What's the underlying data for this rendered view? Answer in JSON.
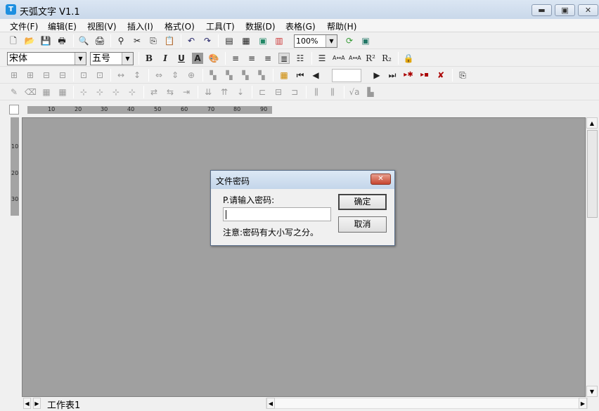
{
  "window": {
    "title": "天弧文字 V1.1",
    "app_icon": "T",
    "controls": [
      "minimize",
      "restore",
      "close"
    ]
  },
  "menu": [
    "文件(F)",
    "编辑(E)",
    "视图(V)",
    "插入(I)",
    "格式(O)",
    "工具(T)",
    "数据(D)",
    "表格(G)",
    "帮助(H)"
  ],
  "toolbar1": {
    "icons": [
      "new-icon",
      "open-icon",
      "save-icon",
      "save-as-icon",
      "|",
      "print-preview-icon",
      "print-icon",
      "|",
      "find-icon",
      "cut-icon",
      "copy-icon",
      "paste-icon",
      "|",
      "undo-icon",
      "redo-icon",
      "|",
      "text-icon",
      "table-icon",
      "image-icon",
      "chart-icon"
    ],
    "zoom": "100%",
    "tail": [
      "refresh-icon",
      "form-icon"
    ]
  },
  "toolbar2": {
    "font": "宋体",
    "size": "五号",
    "icons": [
      "bold-icon",
      "italic-icon",
      "underline-icon",
      "shadow-icon",
      "color-icon",
      "|",
      "align-left-icon",
      "align-center-icon",
      "align-right-icon",
      "justify-icon",
      "distribute-icon",
      "|",
      "line-spacing-icon",
      "grow-font-icon",
      "shrink-font-icon",
      "superscript-icon",
      "subscript-icon",
      "|",
      "lock-icon"
    ],
    "labels": {
      "bold": "B",
      "italic": "I",
      "underline": "U",
      "superscript": "R²",
      "subscript": "R₂"
    }
  },
  "toolbar3": {
    "nav_icons": [
      "first-record-icon",
      "prev-record-icon",
      "next-record-icon",
      "last-record-icon",
      "new-record-icon",
      "save-record-icon",
      "delete-record-icon",
      "|",
      "merge-icon"
    ]
  },
  "ruler": {
    "h_ticks": [
      "10",
      "20",
      "30",
      "40",
      "50",
      "60",
      "70",
      "80",
      "90"
    ],
    "v_ticks": [
      "10",
      "20",
      "30"
    ]
  },
  "sheet_tab": "工作表1",
  "dialog": {
    "title": "文件密码",
    "label": "P.请输入密码:",
    "password": "",
    "note": "注意:密码有大小写之分。",
    "ok": "确定",
    "cancel": "取消"
  }
}
